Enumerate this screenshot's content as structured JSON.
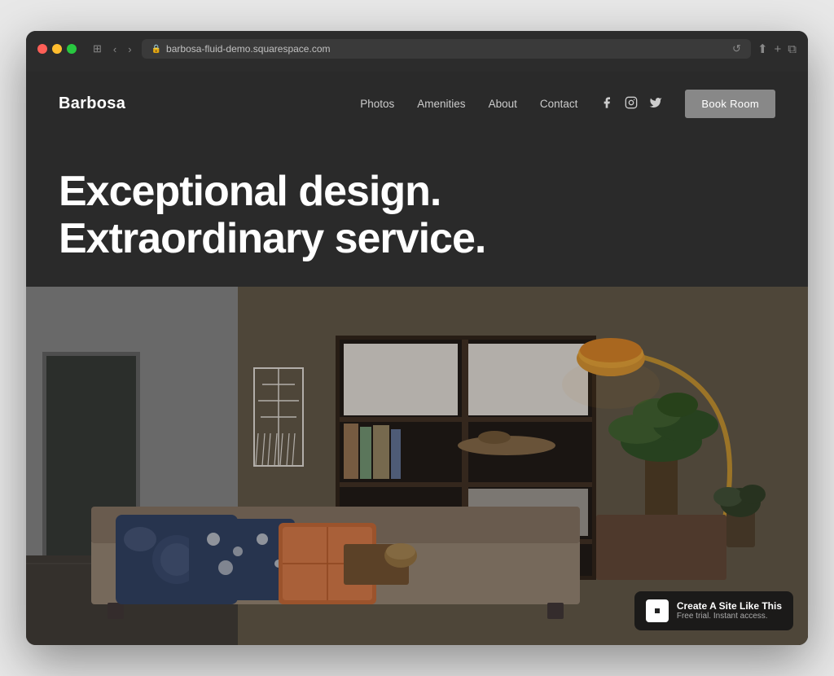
{
  "browser": {
    "url": "barbosa-fluid-demo.squarespace.com",
    "back_btn": "‹",
    "forward_btn": "›",
    "window_icon": "⊞",
    "share_icon": "⬆",
    "new_tab_icon": "+",
    "windows_icon": "⧉",
    "refresh_icon": "↺"
  },
  "nav": {
    "logo": "Barbosa",
    "links": [
      "Photos",
      "Amenities",
      "About",
      "Contact"
    ],
    "social": {
      "facebook": "f",
      "instagram": "◎",
      "twitter": "🐦"
    },
    "cta": "Book Room"
  },
  "hero": {
    "headline_line1": "Exceptional design.",
    "headline_line2": "Extraordinary service."
  },
  "badge": {
    "title": "Create A Site Like This",
    "subtitle": "Free trial. Instant access."
  }
}
